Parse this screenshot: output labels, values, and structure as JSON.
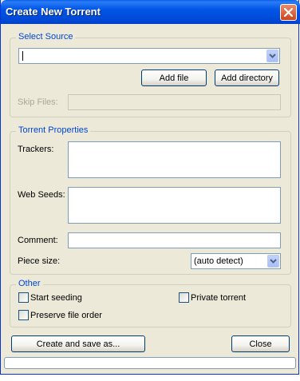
{
  "window": {
    "title": "Create New Torrent"
  },
  "select_source": {
    "legend": "Select Source",
    "source_value": "",
    "add_file_label": "Add file",
    "add_directory_label": "Add directory",
    "skip_files_label": "Skip Files:",
    "skip_files_value": ""
  },
  "torrent_properties": {
    "legend": "Torrent Properties",
    "trackers_label": "Trackers:",
    "trackers_value": "",
    "web_seeds_label": "Web Seeds:",
    "web_seeds_value": "",
    "comment_label": "Comment:",
    "comment_value": "",
    "piece_size_label": "Piece size:",
    "piece_size_value": "(auto detect)"
  },
  "other": {
    "legend": "Other",
    "start_seeding_label": "Start seeding",
    "start_seeding_checked": false,
    "private_torrent_label": "Private torrent",
    "private_torrent_checked": false,
    "preserve_order_label": "Preserve file order",
    "preserve_order_checked": false
  },
  "footer": {
    "create_label": "Create and save as...",
    "close_label": "Close",
    "progress": 0
  },
  "colors": {
    "titlebar": "#0055e5",
    "dialog_bg": "#ece9d8",
    "legend_text": "#0046d5",
    "input_border": "#7f9db9"
  }
}
